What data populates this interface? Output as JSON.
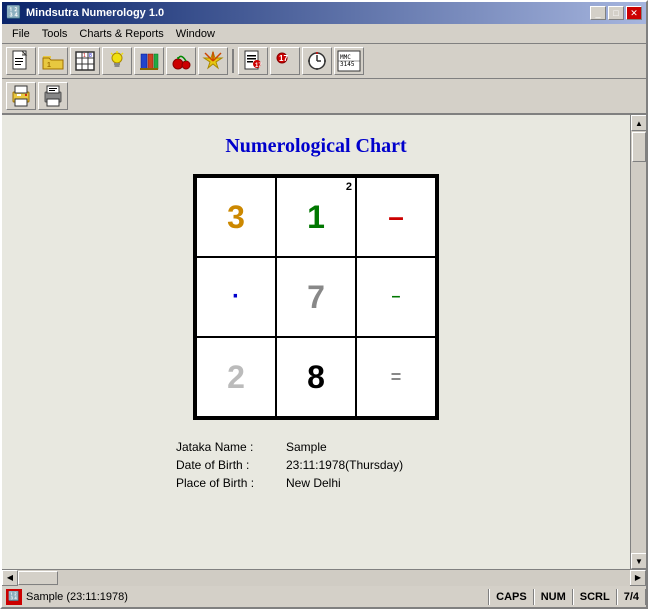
{
  "window": {
    "title": "Mindsutra Numerology 1.0",
    "icon": "🔢"
  },
  "title_bar": {
    "title": "Mindsutra Numerology 1.0",
    "minimize_label": "_",
    "maximize_label": "□",
    "close_label": "✕"
  },
  "menu": {
    "items": [
      {
        "id": "file",
        "label": "File"
      },
      {
        "id": "tools",
        "label": "Tools"
      },
      {
        "id": "charts_reports",
        "label": "Charts & Reports"
      },
      {
        "id": "window",
        "label": "Window"
      }
    ]
  },
  "toolbar": {
    "buttons": [
      {
        "id": "new",
        "icon": "📄"
      },
      {
        "id": "open",
        "icon": "📁"
      },
      {
        "id": "grid",
        "icon": "⊞"
      },
      {
        "id": "bulb",
        "icon": "💡"
      },
      {
        "id": "books",
        "icon": "📚"
      },
      {
        "id": "cherry",
        "icon": "🍒"
      },
      {
        "id": "star",
        "icon": "✴"
      },
      {
        "id": "doc",
        "icon": "📋"
      },
      {
        "id": "num17",
        "icon": "🔴"
      },
      {
        "id": "clock",
        "icon": "🕐"
      },
      {
        "id": "calc",
        "icon": "🔢"
      }
    ]
  },
  "toolbar2": {
    "buttons": [
      {
        "id": "print",
        "icon": "🖨"
      },
      {
        "id": "print2",
        "icon": "🖨"
      }
    ]
  },
  "chart": {
    "title": "Numerological Chart",
    "cells": [
      {
        "row": 0,
        "col": 0,
        "value": "3",
        "color": "yellow",
        "badge": ""
      },
      {
        "row": 0,
        "col": 1,
        "value": "1",
        "color": "green",
        "badge": "2"
      },
      {
        "row": 0,
        "col": 2,
        "value": "–",
        "color": "red",
        "badge": ""
      },
      {
        "row": 1,
        "col": 0,
        "value": "·",
        "color": "blue",
        "badge": ""
      },
      {
        "row": 1,
        "col": 1,
        "value": "7",
        "color": "gray",
        "badge": ""
      },
      {
        "row": 1,
        "col": 2,
        "value": "–",
        "color": "green-small",
        "badge": ""
      },
      {
        "row": 2,
        "col": 0,
        "value": "2",
        "color": "gray-light",
        "badge": ""
      },
      {
        "row": 2,
        "col": 1,
        "value": "8",
        "color": "black",
        "badge": ""
      },
      {
        "row": 2,
        "col": 2,
        "value": "=",
        "color": "gray",
        "badge": ""
      }
    ]
  },
  "info": {
    "rows": [
      {
        "label": "Jataka Name :",
        "value": "Sample"
      },
      {
        "label": "Date of Birth :",
        "value": "23:11:1978(Thursday)"
      },
      {
        "label": "Place of Birth :",
        "value": "New Delhi"
      }
    ]
  },
  "status_bar": {
    "left_text": "Sample (23:11:1978)",
    "segments": [
      "CAPS",
      "NUM",
      "SCRL",
      "7/4"
    ]
  }
}
